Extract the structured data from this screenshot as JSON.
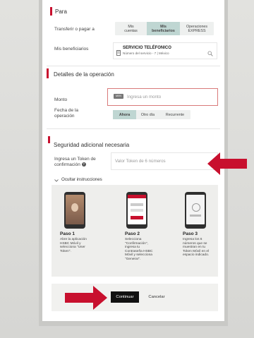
{
  "section_para": {
    "title": "Para",
    "transfer_label": "Transferir o pagar a",
    "options": [
      {
        "line1": "Mis",
        "line2": "cuentas",
        "selected": false
      },
      {
        "line1": "Mis",
        "line2": "beneficiarios",
        "selected": true
      },
      {
        "line1": "Operaciones",
        "line2": "EXPRESS",
        "selected": false
      }
    ],
    "beneficiarios_label": "Mis beneficiarios",
    "beneficiary": {
      "name": "SERVICIO TELÉFONICO",
      "detail": "Número del servicio - 7 | México"
    }
  },
  "section_detalles": {
    "title": "Detalles de la operación",
    "monto_label": "Monto",
    "currency_badge": "MXN",
    "monto_placeholder": "Ingresa un monto",
    "fecha_label": "Fecha de la operación",
    "fecha_options": [
      {
        "label": "Ahora",
        "selected": true
      },
      {
        "label": "Otro día",
        "selected": false
      },
      {
        "label": "Recurrente",
        "selected": false
      }
    ]
  },
  "section_seguridad": {
    "title": "Seguridad adicional necesaria",
    "token_label": "Ingresa un Token de confirmación",
    "token_placeholder": "Valor Token de 6 números",
    "instructions_toggle": "Ocultar instrucciones",
    "steps": [
      {
        "title": "Paso 1",
        "desc": "Abre la aplicación HSBC Móvil y selecciona \"User Token\"."
      },
      {
        "title": "Paso 2",
        "desc": "Selecciona \"Confirmación\", ingresa tu Contraseña HSBC Móvil y selecciona \"Generar\"."
      },
      {
        "title": "Paso 3",
        "desc": "Ingresa los 6 números que se muestran en tu Token Móvil en el espacio indicado."
      }
    ]
  },
  "actions": {
    "continue_label": "Continuar",
    "cancel_label": "Cancelar"
  },
  "colors": {
    "accent_red": "#c8102e",
    "selected_segment": "#bfd6d2",
    "primary_button": "#111111"
  }
}
